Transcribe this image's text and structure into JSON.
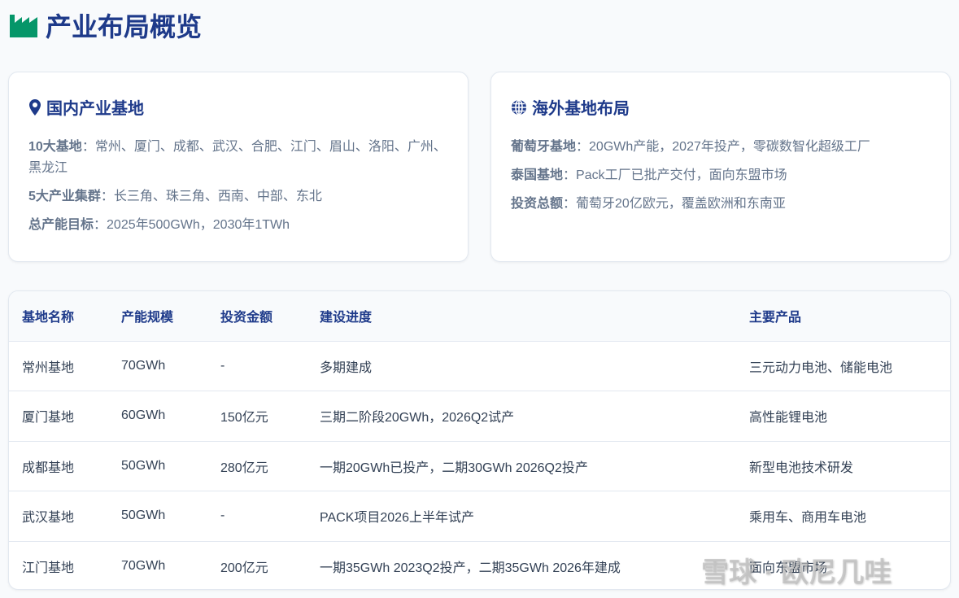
{
  "page": {
    "title": "产业布局概览"
  },
  "domestic": {
    "title": "国内产业基地",
    "items": [
      {
        "label": "10大基地",
        "value": "常州、厦门、成都、武汉、合肥、江门、眉山、洛阳、广州、黑龙江"
      },
      {
        "label": "5大产业集群",
        "value": "长三角、珠三角、西南、中部、东北"
      },
      {
        "label": "总产能目标",
        "value": "2025年500GWh，2030年1TWh"
      }
    ]
  },
  "overseas": {
    "title": "海外基地布局",
    "items": [
      {
        "label": "葡萄牙基地",
        "value": "20GWh产能，2027年投产，零碳数智化超级工厂"
      },
      {
        "label": "泰国基地",
        "value": "Pack工厂已批产交付，面向东盟市场"
      },
      {
        "label": "投资总额",
        "value": "葡萄牙20亿欧元，覆盖欧洲和东南亚"
      }
    ]
  },
  "table": {
    "headers": [
      "基地名称",
      "产能规模",
      "投资金额",
      "建设进度",
      "主要产品"
    ],
    "rows": [
      [
        "常州基地",
        "70GWh",
        "-",
        "多期建成",
        "三元动力电池、储能电池"
      ],
      [
        "厦门基地",
        "60GWh",
        "150亿元",
        "三期二阶段20GWh，2026Q2试产",
        "高性能锂电池"
      ],
      [
        "成都基地",
        "50GWh",
        "280亿元",
        "一期20GWh已投产，二期30GWh 2026Q2投产",
        "新型电池技术研发"
      ],
      [
        "武汉基地",
        "50GWh",
        "-",
        "PACK项目2026上半年试产",
        "乘用车、商用车电池"
      ],
      [
        "江门基地",
        "70GWh",
        "200亿元",
        "一期35GWh 2023Q2投产，二期35GWh 2026年建成",
        "面向东盟市场"
      ]
    ]
  },
  "watermark": "雪球 · 欧尼几哇",
  "colors": {
    "accent": "#1e3a8a",
    "icon_green": "#059669",
    "text_muted": "#64748b"
  }
}
